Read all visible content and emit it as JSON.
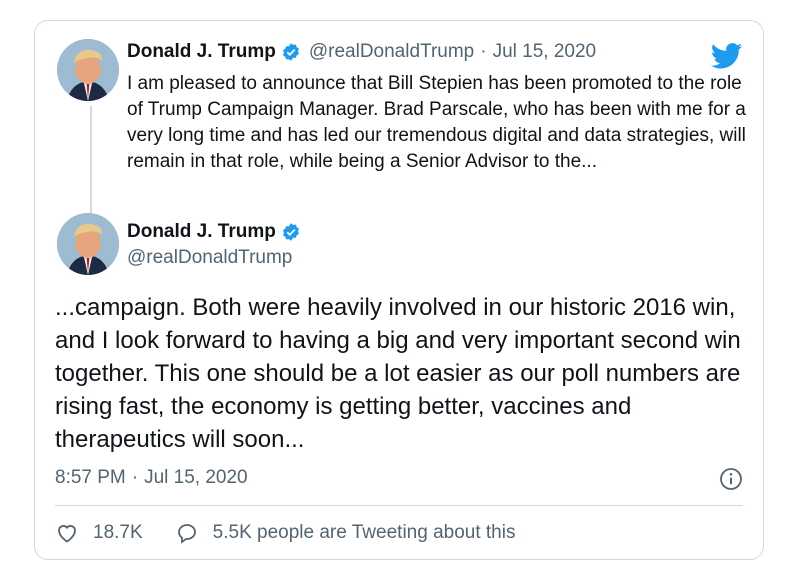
{
  "quoted_tweet": {
    "author_name": "Donald J. Trump",
    "handle": "@realDonaldTrump",
    "separator": "·",
    "date": "Jul 15, 2020",
    "text": "I am pleased to announce that Bill Stepien has been promoted to the role of Trump Campaign Manager. Brad Parscale, who has been with me for a very long time and has led our tremendous digital and data strategies, will remain in that role, while being a Senior Advisor to the..."
  },
  "main_tweet": {
    "author_name": "Donald J. Trump",
    "handle": "@realDonaldTrump",
    "text": "...campaign. Both were heavily involved in our historic 2016 win, and I look forward to having a big and very important second win together. This one should be a lot easier as our poll numbers are rising fast, the economy is getting better, vaccines and therapeutics will soon...",
    "time": "8:57 PM",
    "separator": "·",
    "date": "Jul 15, 2020"
  },
  "actions": {
    "likes": "18.7K",
    "tweeting_about": "5.5K people are Tweeting about this"
  },
  "icons": {
    "brand": "twitter-bird-icon",
    "verified": "verified-badge-icon",
    "like": "heart-icon",
    "reply": "speech-bubble-icon",
    "info": "info-icon"
  },
  "colors": {
    "accent": "#1d9bf0",
    "text": "#0f1419",
    "muted": "#536471",
    "border": "#cfd9de"
  }
}
